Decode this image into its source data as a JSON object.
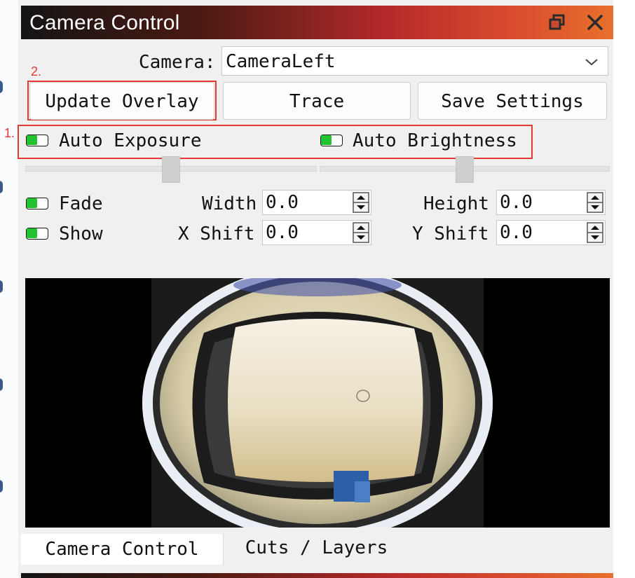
{
  "window": {
    "title": "Camera Control"
  },
  "camera": {
    "label": "Camera:",
    "selected": "CameraLeft"
  },
  "buttons": {
    "update_overlay": "Update Overlay",
    "trace": "Trace",
    "save_settings": "Save Settings"
  },
  "annotations": {
    "box1": "1.",
    "box2": "2."
  },
  "toggles": {
    "auto_exposure": "Auto Exposure",
    "auto_brightness": "Auto Brightness",
    "fade": "Fade",
    "show": "Show"
  },
  "sliders": {
    "exposure_level": 0.5,
    "brightness_level": 0.5
  },
  "fields": {
    "width": {
      "label": "Width",
      "value": "0.0"
    },
    "height": {
      "label": "Height",
      "value": "0.0"
    },
    "x_shift": {
      "label": "X Shift",
      "value": "0.0"
    },
    "y_shift": {
      "label": "Y Shift",
      "value": "0.0"
    }
  },
  "tabs": {
    "camera_control": "Camera Control",
    "cuts_layers": "Cuts / Layers"
  },
  "colors": {
    "annotation_red": "#e53935",
    "toggle_on": "#22c32e"
  }
}
